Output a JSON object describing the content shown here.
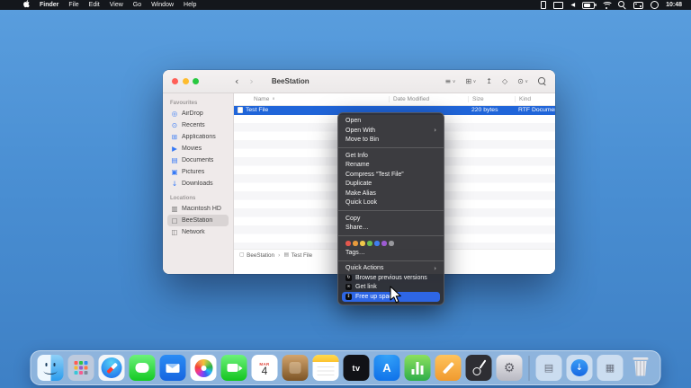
{
  "appearance": {
    "selection_blue": "#2065d9",
    "menu_highlight": "#2e66e5",
    "desktop_top": "#5a9ede",
    "desktop_bottom": "#3e80c5",
    "menubar_bg": "#141416"
  },
  "menubar": {
    "items": [
      "Finder",
      "File",
      "Edit",
      "View",
      "Go",
      "Window",
      "Help"
    ],
    "time": "10:48"
  },
  "window": {
    "title": "BeeStation",
    "toolbar": {
      "back": "‹",
      "forward": "›",
      "view_list": "≡",
      "view_group": "⊞",
      "chevron": "∨",
      "share": "↥",
      "tags": "◇",
      "actions": "⊙"
    },
    "sidebar": {
      "favourites_title": "Favourites",
      "favourites": [
        {
          "label": "AirDrop",
          "glyph": "◎"
        },
        {
          "label": "Recents",
          "glyph": "⊙"
        },
        {
          "label": "Applications",
          "glyph": "⊞"
        },
        {
          "label": "Movies",
          "glyph": "▶"
        },
        {
          "label": "Documents",
          "glyph": "▤"
        },
        {
          "label": "Pictures",
          "glyph": "▣"
        },
        {
          "label": "Downloads",
          "glyph": "↓"
        }
      ],
      "locations_title": "Locations",
      "locations": [
        {
          "label": "Macintosh HD",
          "glyph": "▥"
        },
        {
          "label": "BeeStation",
          "glyph": "▢",
          "selected": true
        },
        {
          "label": "Network",
          "glyph": "◫"
        }
      ]
    },
    "columns": {
      "name": "Name",
      "date": "Date Modified",
      "size": "Size",
      "kind": "Kind",
      "sort": "∧"
    },
    "file": {
      "name": "Test File",
      "size": "220 bytes",
      "kind": "RTF Document"
    },
    "pathbar": {
      "sep": "›",
      "crumbs": [
        {
          "label": "BeeStation",
          "glyph": "▢"
        },
        {
          "label": "Test File",
          "glyph": "▤"
        }
      ]
    }
  },
  "context_menu": {
    "g1": [
      {
        "label": "Open"
      },
      {
        "label": "Open With",
        "submenu": "›"
      },
      {
        "label": "Move to Bin"
      }
    ],
    "g2": [
      {
        "label": "Get Info"
      },
      {
        "label": "Rename"
      },
      {
        "label": "Compress “Test File”"
      },
      {
        "label": "Duplicate"
      },
      {
        "label": "Make Alias"
      },
      {
        "label": "Quick Look"
      }
    ],
    "g3": [
      {
        "label": "Copy"
      },
      {
        "label": "Share…"
      }
    ],
    "tags": {
      "label": "Tags…",
      "colors": [
        "#e4574d",
        "#e79a3c",
        "#f0c84a",
        "#6bbf53",
        "#3f7ef0",
        "#9d5bd2",
        "#98989d"
      ]
    },
    "g5": [
      {
        "label": "Quick Actions",
        "submenu": "›"
      },
      {
        "label": "Browse previous versions",
        "glyph": "↻"
      },
      {
        "label": "Get link",
        "glyph": "∞"
      },
      {
        "label": "Free up space",
        "glyph": "↥",
        "highlighted": true
      }
    ]
  },
  "dock": {
    "calendar": {
      "month": "MAR",
      "day": "4"
    },
    "tv_label": "tv",
    "appstore_label": "A",
    "settings_glyph": "⚙",
    "downloads_glyph": "↓",
    "tray1_glyph": "▤",
    "tray2_glyph": "▦"
  }
}
